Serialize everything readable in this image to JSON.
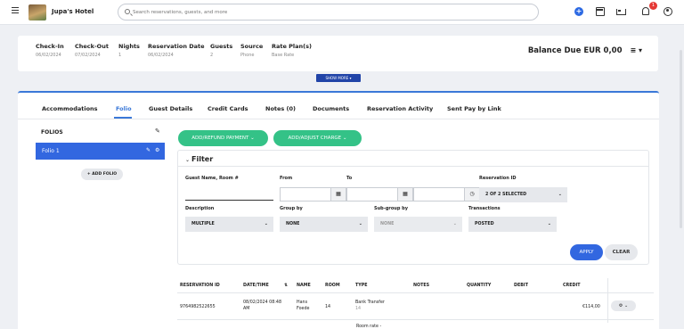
{
  "header": {
    "hotel_name": "Jupa's Hotel",
    "search_placeholder": "Search reservations, guests, and more",
    "notification_count": "1"
  },
  "summary": {
    "fields": [
      {
        "label": "Check-In",
        "value": "06/02/2024"
      },
      {
        "label": "Check-Out",
        "value": "07/02/2024"
      },
      {
        "label": "Nights",
        "value": "1"
      },
      {
        "label": "Reservation Date",
        "value": "06/02/2024"
      },
      {
        "label": "Guests",
        "value": "2"
      },
      {
        "label": "Source",
        "value": "Phone"
      },
      {
        "label": "Rate Plan(s)",
        "value": "Base Rate"
      }
    ],
    "balance": "Balance Due EUR 0,00",
    "show_more": "SHOW MORE"
  },
  "tabs": [
    "Accommodations",
    "Folio",
    "Guest Details",
    "Credit Cards",
    "Notes (0)",
    "Documents",
    "Reservation Activity",
    "Sent Pay by Link"
  ],
  "folios": {
    "title": "FOLIOS",
    "items": [
      "Folio 1"
    ],
    "add_label": "ADD FOLIO"
  },
  "actions": {
    "add_refund": "ADD/REFUND PAYMENT",
    "add_adjust": "ADD/ADJUST CHARGE"
  },
  "filter": {
    "title": "Filter",
    "guest_label": "Guest Name, Room #",
    "from_label": "From",
    "to_label": "To",
    "reservation_id_label": "Reservation ID",
    "reservation_id_value": "2 OF 2 SELECTED",
    "description_label": "Description",
    "description_value": "MULTIPLE",
    "group_by_label": "Group by",
    "group_by_value": "NONE",
    "subgroup_label": "Sub-group by",
    "subgroup_value": "NONE",
    "transactions_label": "Transactions",
    "transactions_value": "POSTED",
    "apply": "APPLY",
    "clear": "CLEAR"
  },
  "table": {
    "headers": [
      "RESERVATION ID",
      "DATE/TIME",
      "NAME",
      "ROOM",
      "TYPE",
      "NOTES",
      "QUANTITY",
      "DEBIT",
      "CREDIT"
    ],
    "rows": [
      {
        "reservation_id": "9764982522655",
        "datetime_1": "08/02/2024 08:48",
        "datetime_2": "AM",
        "name_1": "Hans",
        "name_2": "Foede",
        "room": "14",
        "type_1": "Bank Transfer",
        "type_2": "14",
        "credit": "€114,00"
      }
    ],
    "next_row_type": "Room rate -"
  }
}
